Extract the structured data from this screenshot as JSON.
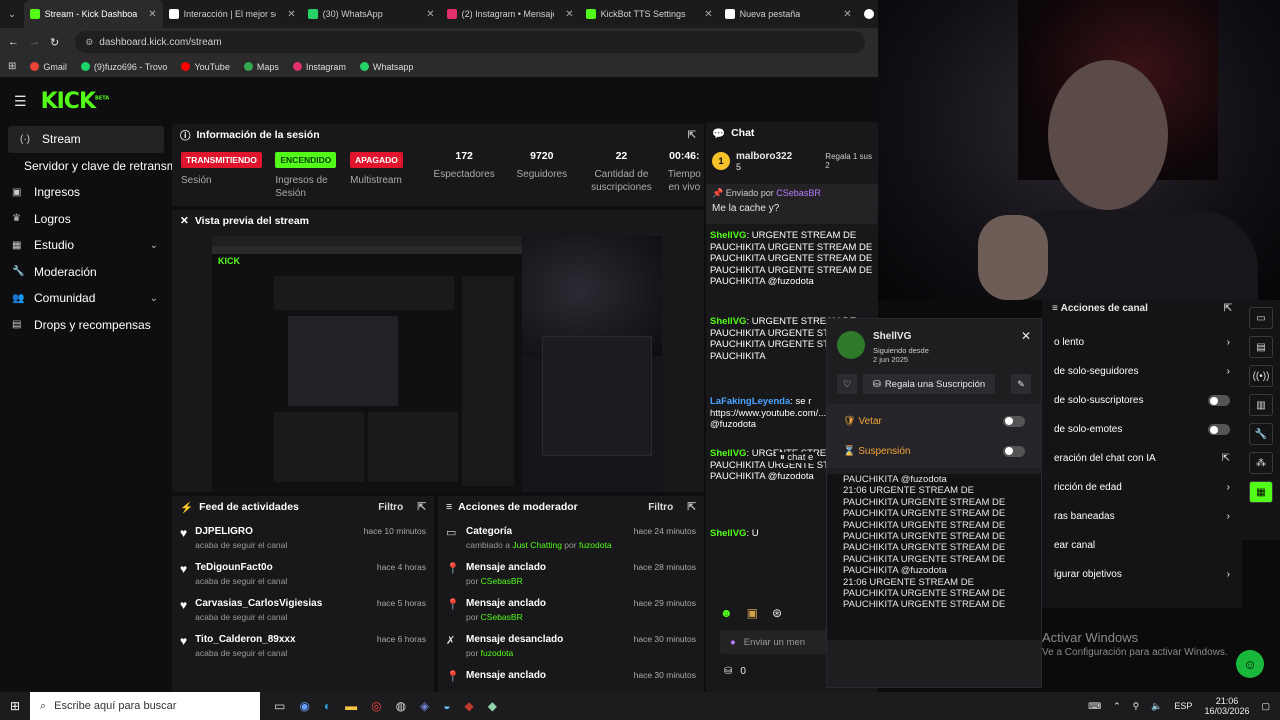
{
  "tabs": [
    {
      "label": "Stream - Kick Dashboard",
      "color": "#53fc18",
      "active": true
    },
    {
      "label": "Interacción | El mejor soft",
      "color": "#ffffff"
    },
    {
      "label": "(30) WhatsApp",
      "color": "#25d366"
    },
    {
      "label": "(2) Instagram • Mensajes",
      "color": "#e1306c"
    },
    {
      "label": "KickBot TTS Settings",
      "color": "#53fc18"
    },
    {
      "label": "Nueva pestaña",
      "color": "#ffffff"
    }
  ],
  "address": {
    "url": "dashboard.kick.com/stream"
  },
  "bookmarks": [
    {
      "label": "Gmail",
      "color": "#ea4335"
    },
    {
      "label": "(9)fuzo696 - Trovo",
      "color": "#19d66b"
    },
    {
      "label": "YouTube",
      "color": "#ff0000"
    },
    {
      "label": "Maps",
      "color": "#34a853"
    },
    {
      "label": "Instagram",
      "color": "#e1306c"
    },
    {
      "label": "Whatsapp",
      "color": "#25d366"
    }
  ],
  "brand": {
    "logo": "KICK",
    "beta": "BETA"
  },
  "sidebar": {
    "items": [
      {
        "label": "Stream",
        "icon": "stream-icon",
        "active": true
      },
      {
        "label": "Servidor y clave de retransmi",
        "icon": ""
      },
      {
        "label": "Ingresos",
        "icon": "revenue-icon"
      },
      {
        "label": "Logros",
        "icon": "trophy-icon"
      },
      {
        "label": "Estudio",
        "icon": "studio-icon",
        "chev": true
      },
      {
        "label": "Moderación",
        "icon": "wrench-icon"
      },
      {
        "label": "Comunidad",
        "icon": "community-icon",
        "chev": true
      },
      {
        "label": "Drops y recompensas",
        "icon": "drops-icon"
      }
    ]
  },
  "session": {
    "title": "Información de la sesión",
    "stats": [
      {
        "badge": "TRANSMITIENDO",
        "bg": "#e0142c",
        "fg": "#ffffff",
        "label": "Sesión"
      },
      {
        "badge": "ENCENDIDO",
        "bg": "#53fc18",
        "fg": "#0b3d00",
        "label": "Ingresos de Sesión"
      },
      {
        "badge": "APAGADO",
        "bg": "#e0142c",
        "fg": "#ffffff",
        "label": "Multistream"
      },
      {
        "value": "172",
        "label": "Espectadores"
      },
      {
        "value": "9720",
        "label": "Seguidores"
      },
      {
        "value": "22",
        "label": "Cantidad de suscripciones"
      },
      {
        "value": "00:46:",
        "label": "Tiempo en vivo"
      }
    ]
  },
  "preview": {
    "title": "Vista previa del stream"
  },
  "feed": {
    "title": "Feed de actividades",
    "filter": "Filtro",
    "rows": [
      {
        "name": "DJPELIGRO",
        "sub": "acaba de seguir el canal",
        "time": "hace 10 minutos"
      },
      {
        "name": "TeDigounFact0o",
        "sub": "acaba de seguir el canal",
        "time": "hace 4 horas"
      },
      {
        "name": "Carvasias_CarlosVigiesias",
        "sub": "acaba de seguir el canal",
        "time": "hace 5 horas"
      },
      {
        "name": "Tito_Calderon_89xxx",
        "sub": "acaba de seguir el canal",
        "time": "hace 6 horas"
      }
    ]
  },
  "mod": {
    "title": "Acciones de moderador",
    "filter": "Filtro",
    "rows": [
      {
        "name": "Categoría",
        "pre": "cambiado a ",
        "a": "Just Chatting",
        "mid": " por ",
        "b": "fuzodota",
        "time": "hace 24 minutos",
        "icon": "category-icon"
      },
      {
        "name": "Mensaje anclado",
        "pre": "por ",
        "a": "CSebasBR",
        "mid": "",
        "b": "",
        "time": "hace 28 minutos",
        "icon": "pin-icon"
      },
      {
        "name": "Mensaje anclado",
        "pre": "por ",
        "a": "CSebasBR",
        "mid": "",
        "b": "",
        "time": "hace 29 minutos",
        "icon": "pin-icon"
      },
      {
        "name": "Mensaje desanclado",
        "pre": "por ",
        "a": "fuzodota",
        "mid": "",
        "b": "",
        "time": "hace 30 minutos",
        "icon": "unpin-icon"
      },
      {
        "name": "Mensaje anclado",
        "pre": "",
        "a": "",
        "mid": "",
        "b": "",
        "time": "hace 30 minutos",
        "icon": "pin-icon"
      }
    ]
  },
  "chat": {
    "title": "Chat",
    "top_user": "malboro322",
    "top_count": "5",
    "gift_text": "Regala 1 sus",
    "gift_count": "2",
    "pinned_by_label": "Enviado por",
    "pinned_by_user": "CSebasBR",
    "pinned_msg": "Me la cache y?",
    "messages": [
      {
        "user": "ShellVG",
        "text": "URGENTE STREAM DE PAUCHIKITA URGENTE STREAM DE PAUCHIKITA URGENTE STREAM DE PAUCHIKITA URGENTE STREAM DE PAUCHIKITA @fuzodota"
      },
      {
        "user": "ShellVG",
        "text": "URGENTE STREAM DE PAUCHIKITA URGENTE STREAM DE PAUCHIKITA URGENTE STREAM DE PAUCHIKITA"
      },
      {
        "user": "LaFakingLeyenda",
        "text": "se r https://www.youtube.com/... V @fuzodota"
      },
      {
        "user": "ShellVG",
        "text": "URGENTE STREAM DE PAUCHIKITA URGENTE STREAM DE PAUCHIKITA @fuzodota"
      },
      {
        "user": "ShellVG",
        "text": "U"
      }
    ],
    "paused": "chat e",
    "input_placeholder": "Enviar un men",
    "bottom_count": "0"
  },
  "modal": {
    "user": "ShellVG",
    "following_label": "Siguiendo desde",
    "following_date": "2 jun 2025",
    "gift_button": "Regala una Suscripción",
    "ban_label": "Vetar",
    "timeout_label": "Suspensión",
    "log_lines": [
      "PAUCHIKITA @fuzodota",
      "21:06 URGENTE STREAM DE",
      "PAUCHIKITA URGENTE STREAM DE",
      "PAUCHIKITA URGENTE STREAM DE",
      "PAUCHIKITA URGENTE STREAM DE",
      "PAUCHIKITA URGENTE STREAM DE",
      "PAUCHIKITA URGENTE STREAM DE",
      "PAUCHIKITA URGENTE STREAM DE",
      "PAUCHIKITA @fuzodota",
      "21:06 URGENTE STREAM DE",
      "PAUCHIKITA URGENTE STREAM DE",
      "PAUCHIKITA URGENTE STREAM DE"
    ]
  },
  "channel_actions": {
    "title": "Acciones de canal",
    "items": [
      {
        "label": "o lento",
        "ctl": "chev"
      },
      {
        "label": "de solo-seguidores",
        "ctl": "chev"
      },
      {
        "label": "de solo-suscriptores",
        "ctl": "toggle"
      },
      {
        "label": "de solo-emotes",
        "ctl": "toggle"
      },
      {
        "label": "eración del chat con IA",
        "ctl": "ext"
      },
      {
        "label": "ricción de edad",
        "ctl": "chev"
      },
      {
        "label": "ras baneadas",
        "ctl": "chev"
      },
      {
        "label": "ear canal",
        "ctl": "none"
      },
      {
        "label": "igurar objetivos",
        "ctl": "chev"
      }
    ]
  },
  "watermark": {
    "line1": "Activar Windows",
    "line2": "Ve a Configuración para activar Windows."
  },
  "taskbar": {
    "search": "Escribe aquí para buscar",
    "lang": "ESP",
    "time": "21:06",
    "date": "16/03/2026"
  }
}
